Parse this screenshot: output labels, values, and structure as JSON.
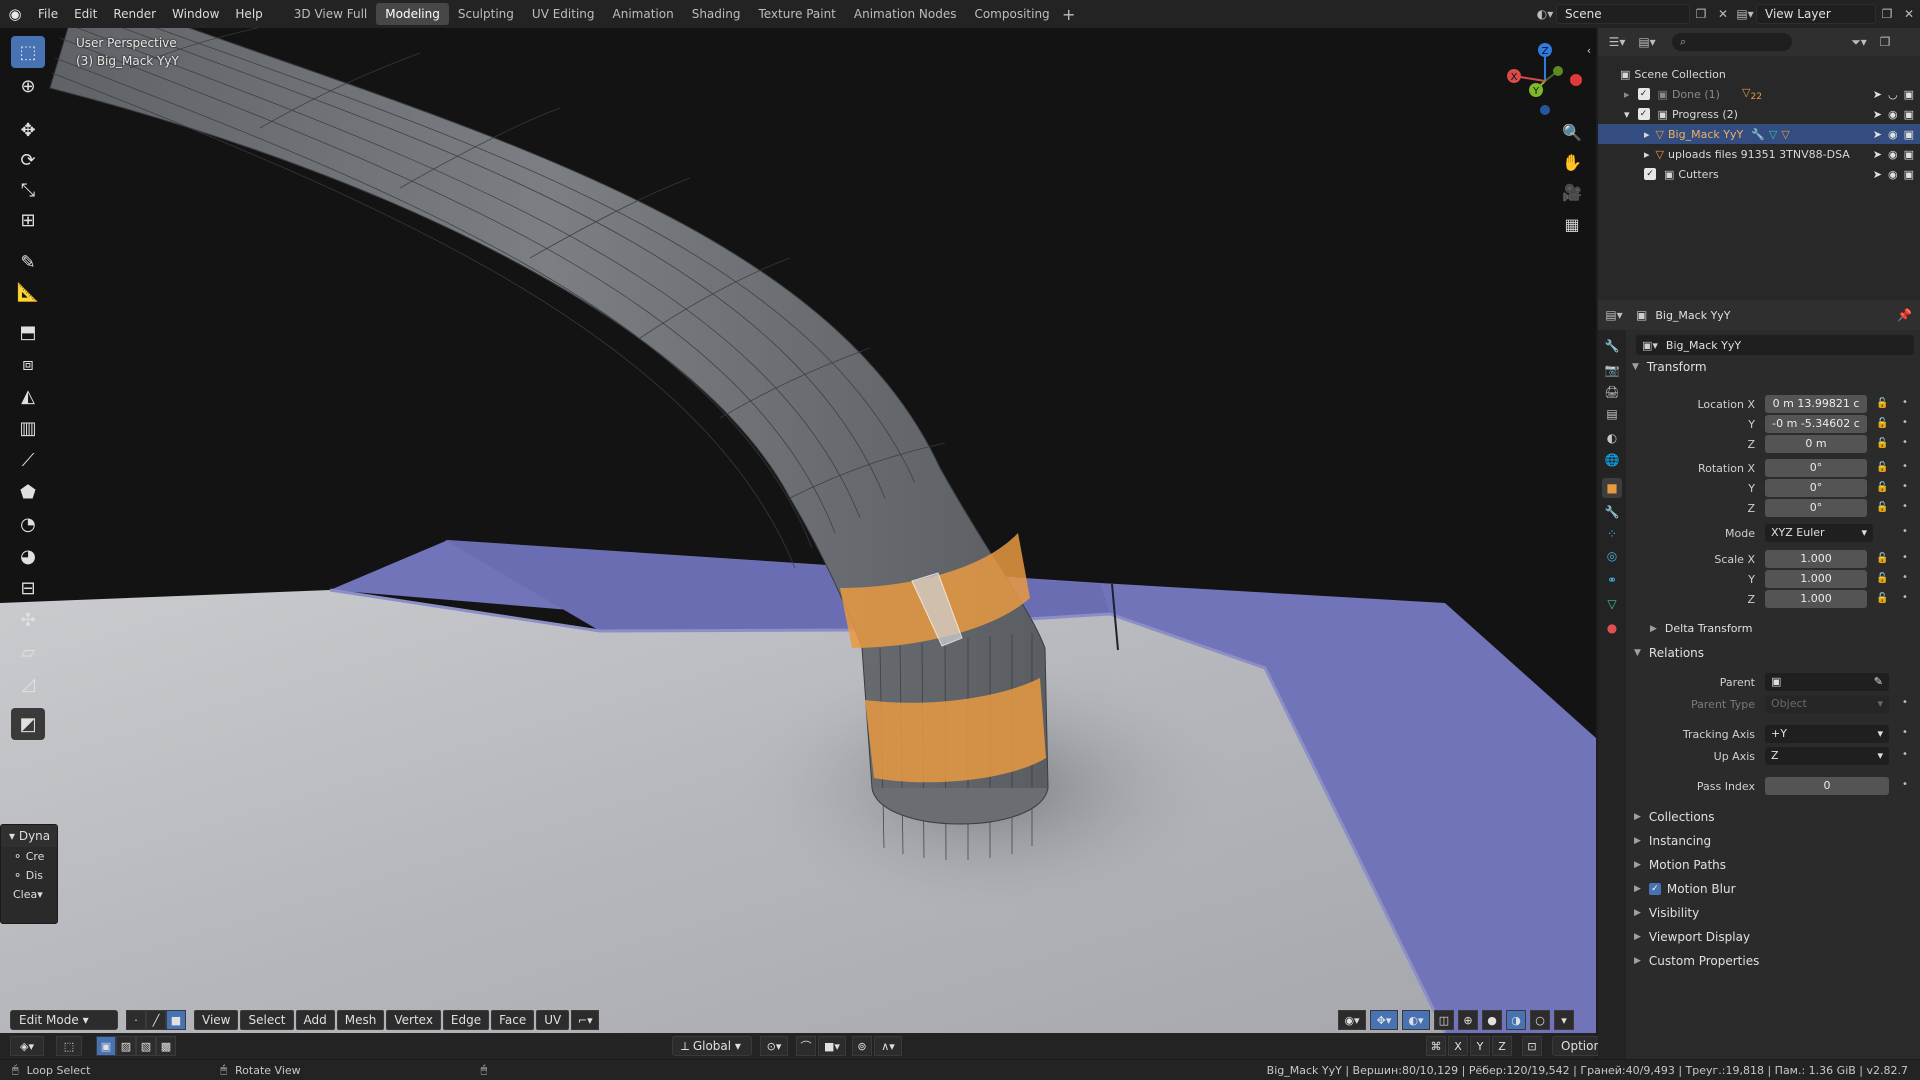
{
  "topbar": {
    "menus": [
      "File",
      "Edit",
      "Render",
      "Window",
      "Help"
    ],
    "workspaces": [
      "3D View Full",
      "Modeling",
      "Sculpting",
      "UV Editing",
      "Animation",
      "Shading",
      "Texture Paint",
      "Animation Nodes",
      "Compositing"
    ],
    "active_workspace": "Modeling",
    "scene": "Scene",
    "view_layer": "View Layer"
  },
  "viewport": {
    "view_name": "User Perspective",
    "object_label": "(3) Big_Mack YyY",
    "gizmo": {
      "z": "Z",
      "y": "Y",
      "x": "X"
    }
  },
  "tool_panel": {
    "title": "Dyna",
    "rows": [
      "Cre",
      "Dis",
      "Clea"
    ]
  },
  "viewport_header": {
    "mode": "Edit Mode",
    "menus": [
      "View",
      "Select",
      "Add",
      "Mesh",
      "Vertex",
      "Edge",
      "Face",
      "UV"
    ]
  },
  "tool_settings": {
    "orientation": "Global",
    "options": "Options",
    "axes": [
      "X",
      "Y",
      "Z"
    ]
  },
  "statusbar": {
    "left_action": "Loop Select",
    "middle_action": "Rotate View",
    "stats": "Big_Mack YyY | Вершин:80/10,129 | Рёбер:120/19,542 | Граней:40/9,493 | Треуг.:19,818 | Пам.: 1.36 GiB | v2.82.7"
  },
  "outliner": {
    "root": "Scene Collection",
    "items": [
      {
        "label": "Done (1)",
        "depth": 1,
        "selected": false,
        "dim": true
      },
      {
        "label": "Progress (2)",
        "depth": 1,
        "selected": false,
        "dim": false
      },
      {
        "label": "Big_Mack YyY",
        "depth": 2,
        "selected": true,
        "dim": false
      },
      {
        "label": "uploads files 91351 3TNV88-DSA",
        "depth": 2,
        "selected": false,
        "dim": false
      },
      {
        "label": "Cutters",
        "depth": 1,
        "selected": false,
        "dim": false
      }
    ],
    "done_badge": "22"
  },
  "properties": {
    "object_name": "Big_Mack YyY",
    "datablock_name": "Big_Mack YyY",
    "transform": {
      "title": "Transform",
      "location_label": "Location X",
      "location": [
        "0 m 13.99821 c",
        "-0 m -5.34602 c",
        "0 m"
      ],
      "rotation_label": "Rotation X",
      "rotation": [
        "0°",
        "0°",
        "0°"
      ],
      "mode_label": "Mode",
      "mode": "XYZ Euler",
      "scale_label": "Scale X",
      "scale": [
        "1.000",
        "1.000",
        "1.000"
      ],
      "y_label": "Y",
      "z_label": "Z"
    },
    "delta_transform": "Delta Transform",
    "relations": {
      "title": "Relations",
      "parent_label": "Parent",
      "parent_type_label": "Parent Type",
      "parent_type": "Object",
      "tracking_axis_label": "Tracking Axis",
      "tracking_axis": "+Y",
      "up_axis_label": "Up Axis",
      "up_axis": "Z",
      "pass_index_label": "Pass Index",
      "pass_index": "0"
    },
    "collapsed_sections": [
      "Collections",
      "Instancing",
      "Motion Paths",
      "Motion Blur",
      "Visibility",
      "Viewport Display",
      "Custom Properties"
    ],
    "motion_blur_checked": true
  },
  "colors": {
    "accent": "#4772b3",
    "selection": "#e89a42",
    "plane": "#b6b8bd",
    "plane_edge": "#7a7fc8",
    "tube": "#717579"
  }
}
